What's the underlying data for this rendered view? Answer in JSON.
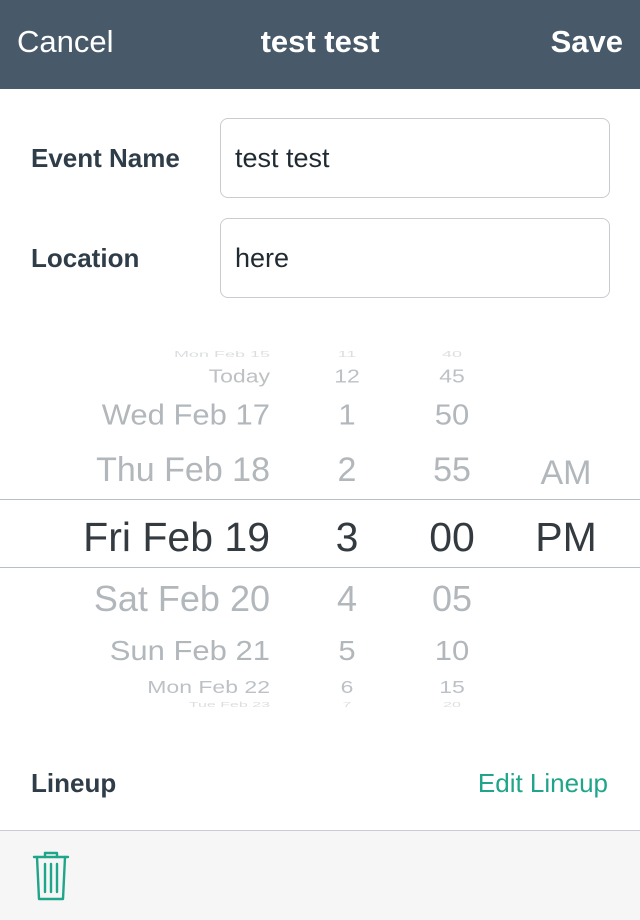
{
  "nav": {
    "cancel_label": "Cancel",
    "title": "test test",
    "save_label": "Save"
  },
  "form": {
    "event_name_label": "Event Name",
    "event_name_value": "test test",
    "location_label": "Location",
    "location_value": "here"
  },
  "picker": {
    "dates": [
      "Mon Feb 15",
      "Today",
      "Wed Feb 17",
      "Thu Feb 18",
      "Fri Feb 19",
      "Sat Feb 20",
      "Sun Feb 21",
      "Mon Feb 22",
      "Tue Feb 23"
    ],
    "hours": [
      "11",
      "12",
      "1",
      "2",
      "3",
      "4",
      "5",
      "6",
      "7"
    ],
    "minutes": [
      "40",
      "45",
      "50",
      "55",
      "00",
      "05",
      "10",
      "15",
      "20"
    ],
    "ampm": [
      "AM",
      "PM"
    ],
    "selected": {
      "date": "Fri Feb 19",
      "hour": "3",
      "minute": "00",
      "ampm": "PM"
    }
  },
  "lineup": {
    "label": "Lineup",
    "edit_label": "Edit Lineup"
  },
  "toolbar": {
    "delete_icon": "trash-icon"
  },
  "colors": {
    "navbar": "#485a69",
    "accent": "#1fa58a",
    "text": "#2f3d49"
  }
}
